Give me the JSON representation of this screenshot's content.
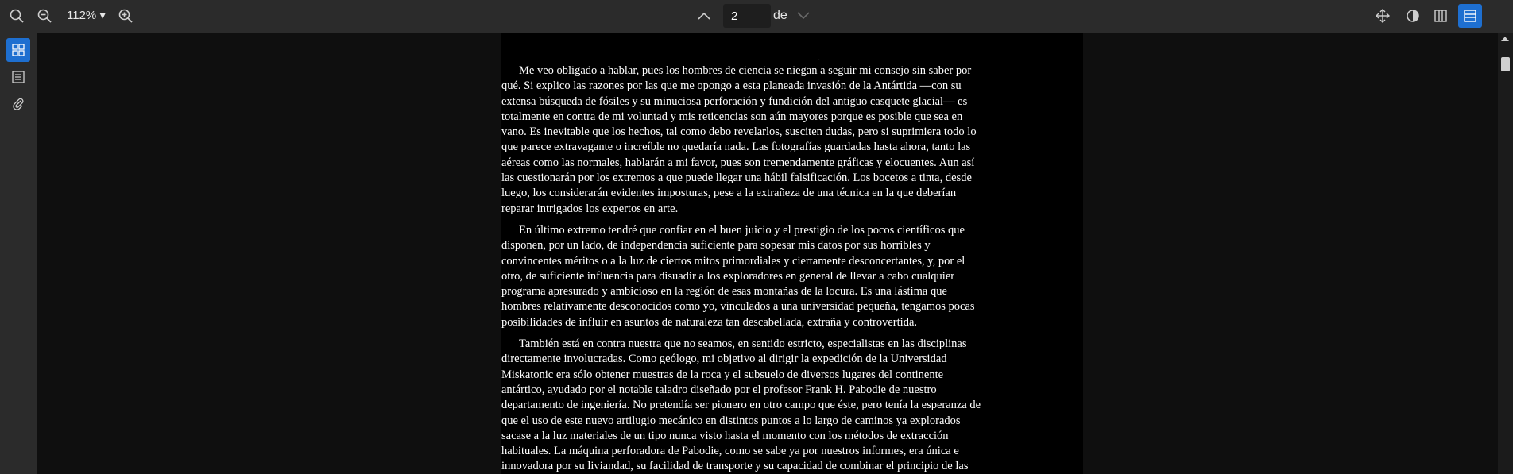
{
  "toolbar": {
    "zoom_label": "112% ▾",
    "page_number": "2",
    "page_of": "de",
    "icons": [
      "search-icon",
      "zoom-out-icon",
      "zoom-in-icon",
      "previous-page-icon",
      "next-page-icon",
      "pan-tool-icon",
      "theme-icon",
      "two-page-view-icon",
      "scroll-view-icon"
    ]
  },
  "sidebar": {
    "icons": [
      "thumbnails-icon",
      "outline-icon",
      "attachments-icon"
    ]
  },
  "document": {
    "paragraphs": [
      [
        "Me   veo  obligado  a    hablar,     pues los   hombres   de   ciencia    se    niegan    a    seguir     mi  consejo   sin  saber       por",
        "qué.  Si    explico    las   razones    por  las   que  me  opongo    a     esta planeada  invasión  de   la   Antártida         —con     su",
        "extensa   búsqueda de     fósiles      y       su   minuciosa      perforación      y      fundición del   antiguo      casquete  glacial— es",
        "totalmente        en    contra      de    mi  voluntad y      mis  reticencias      son aún  mayores  porque      es   posible    que   sea   en",
        "vano.     Es    inevitable      que  los   hechos,    tal    como       debo        revelarlos,       susciten  dudas,       pero si    suprimiera       todo lo",
        "que  parece      extravagante      o      increíble  no    quedaría  nada.       Las  fotografías      guardadas          hasta        ahora,      tanto          las",
        "aéreas      como        las  normales,      hablarán  a        mi   favor,      pues son   tremendamente         gráficas   y       elocuentes.        Aun así",
        "las  cuestionarán   por   los   extremos a       que  puede       llegar       una  hábil        falsificación.   Los bocetos    a      tinta,          desde",
        "luego,   los   considerarán   evidentes          imposturas,      pese          a        la     extrañeza         de    una  técnica     en    la    que  deberían",
        "reparar       intrigados         los     expertos    en       arte."
      ],
      [
        "En     último      extremo tendré      que confiar     en   el    buen      juicio      y      el   prestigio de   los  pocos       científicos        que",
        "disponen,  por   un    lado,        de    independencia       suficiente          para         sopesar   mis  datos         por  sus  horribles  y",
        "convincentes   méritos    o         a      la  luz  de   ciertos     mitos        primordiales   y       ciertamente         desconcertantes,        y,    por    el",
        "otro, de      suficiente           influencia          para        disuadir  a       los   exploradores    en     general   de     llevar        a     cabo          cualquier",
        "programa  apresurado       y      ambicioso       en     la     región    de     esas       montañas     de    la   locura.     Es    una lástima   que",
        "hombres  relativamente  desconocidos   como        yo,    vinculados         a       una  universidad    pequeña, tengamos pocas",
        "posibilidades    de       influir         en      asuntos     de      naturaleza          tan     descabellada,    extraña      y          controvertida."
      ],
      [
        "También  está en      contra        nuestra     que  no     seamos,    en       sentido      estricto,     especialistas      en      las   disciplinas",
        "directamente        involucradas.    Como         geólogo,   mi   objetivo   al       dirigir        la    expedición           de   la     Universidad",
        "Miskatonic        era  sólo       obtener  muestras de    la    roca       y        el     subsuelo  de   diversos  lugares     del   continente",
        "antártico,  ayudado   por   el       notable      taladro       diseñado por  el       profesor   Frank         H.    Pabodie    de      nuestro",
        "departamento   de     ingeniería.     No     pretendía ser    pionero     en    otro campo      que  éste, pero tenía          la     esperanza          de",
        "que    el      uso  de   este nuevo       artilugio  mecánico             en     distintos  puntos      a      lo     largo          de    caminos   ya     explorados",
        "sacase     a    la luz  materiales       de    un    tipo  nunca        visto           hasta        el    momento          con  los  métodos    de          extracción",
        "habituales.      La     máquina  perforadora       de    Pabodie,  como       se     sabe          ya    por  nuestros   informes,          era  única       e",
        "innovadora         por   su      liviandad,          su     facilidad  de     transporte         y       su   capacidad          de    combinar el   principio de     las"
      ]
    ]
  }
}
